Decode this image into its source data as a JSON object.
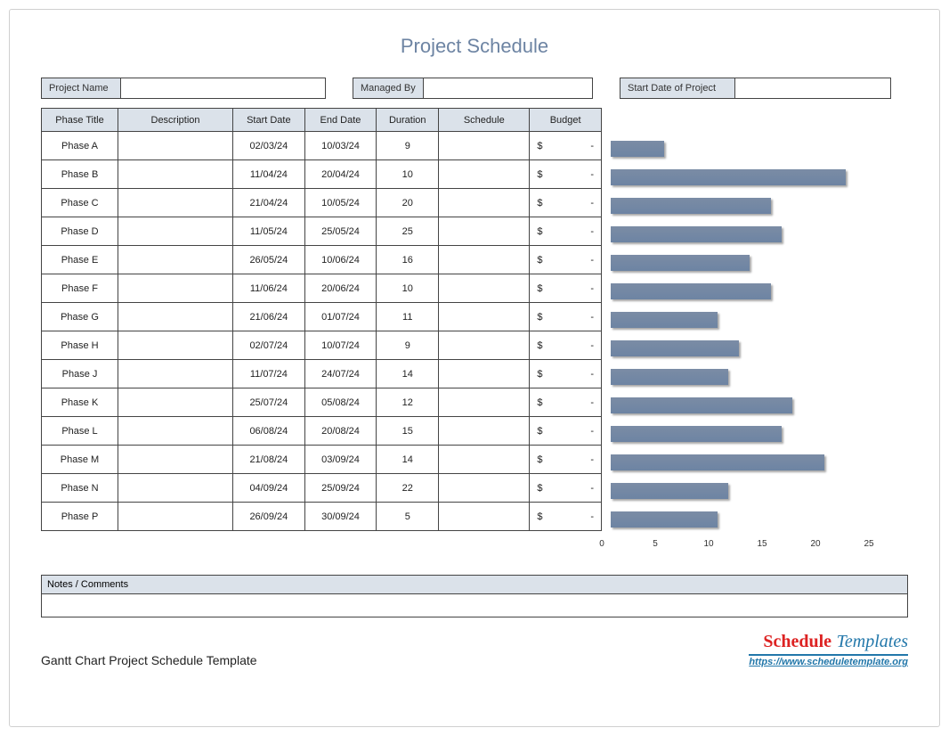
{
  "page": {
    "title": "Project Schedule",
    "footer_left": "Gantt Chart Project Schedule Template",
    "footer_brand_a": "Schedule",
    "footer_brand_b": "Templates",
    "footer_url": "https://www.scheduletemplate.org"
  },
  "meta": {
    "project_name_label": "Project Name",
    "project_name_value": "",
    "managed_by_label": "Managed By",
    "managed_by_value": "",
    "start_date_label": "Start Date of Project",
    "start_date_value": ""
  },
  "columns": {
    "phase": "Phase Title",
    "desc": "Description",
    "start": "Start Date",
    "end": "End Date",
    "dur": "Duration",
    "sched": "Schedule",
    "budget": "Budget"
  },
  "budget_prefix": "$",
  "budget_dash": "-",
  "notes_label": "Notes / Comments",
  "rows": [
    {
      "phase": "Phase A",
      "desc": "",
      "start": "02/03/24",
      "end": "10/03/24",
      "dur": "9",
      "sched": "",
      "budget": "",
      "bar": 5
    },
    {
      "phase": "Phase B",
      "desc": "",
      "start": "11/04/24",
      "end": "20/04/24",
      "dur": "10",
      "sched": "",
      "budget": "",
      "bar": 22
    },
    {
      "phase": "Phase C",
      "desc": "",
      "start": "21/04/24",
      "end": "10/05/24",
      "dur": "20",
      "sched": "",
      "budget": "",
      "bar": 15
    },
    {
      "phase": "Phase D",
      "desc": "",
      "start": "11/05/24",
      "end": "25/05/24",
      "dur": "25",
      "sched": "",
      "budget": "",
      "bar": 16
    },
    {
      "phase": "Phase E",
      "desc": "",
      "start": "26/05/24",
      "end": "10/06/24",
      "dur": "16",
      "sched": "",
      "budget": "",
      "bar": 13
    },
    {
      "phase": "Phase F",
      "desc": "",
      "start": "11/06/24",
      "end": "20/06/24",
      "dur": "10",
      "sched": "",
      "budget": "",
      "bar": 15
    },
    {
      "phase": "Phase G",
      "desc": "",
      "start": "21/06/24",
      "end": "01/07/24",
      "dur": "11",
      "sched": "",
      "budget": "",
      "bar": 10
    },
    {
      "phase": "Phase H",
      "desc": "",
      "start": "02/07/24",
      "end": "10/07/24",
      "dur": "9",
      "sched": "",
      "budget": "",
      "bar": 12
    },
    {
      "phase": "Phase J",
      "desc": "",
      "start": "11/07/24",
      "end": "24/07/24",
      "dur": "14",
      "sched": "",
      "budget": "",
      "bar": 11
    },
    {
      "phase": "Phase K",
      "desc": "",
      "start": "25/07/24",
      "end": "05/08/24",
      "dur": "12",
      "sched": "",
      "budget": "",
      "bar": 17
    },
    {
      "phase": "Phase L",
      "desc": "",
      "start": "06/08/24",
      "end": "20/08/24",
      "dur": "15",
      "sched": "",
      "budget": "",
      "bar": 16
    },
    {
      "phase": "Phase M",
      "desc": "",
      "start": "21/08/24",
      "end": "03/09/24",
      "dur": "14",
      "sched": "",
      "budget": "",
      "bar": 20
    },
    {
      "phase": "Phase N",
      "desc": "",
      "start": "04/09/24",
      "end": "25/09/24",
      "dur": "22",
      "sched": "",
      "budget": "",
      "bar": 11
    },
    {
      "phase": "Phase P",
      "desc": "",
      "start": "26/09/24",
      "end": "30/09/24",
      "dur": "5",
      "sched": "",
      "budget": "",
      "bar": 10
    }
  ],
  "chart_data": {
    "type": "bar",
    "orientation": "horizontal",
    "title": "",
    "xlabel": "",
    "ylabel": "",
    "xlim": [
      0,
      25
    ],
    "xticks": [
      0,
      5,
      10,
      15,
      20,
      25
    ],
    "categories": [
      "Phase A",
      "Phase B",
      "Phase C",
      "Phase D",
      "Phase E",
      "Phase F",
      "Phase G",
      "Phase H",
      "Phase J",
      "Phase K",
      "Phase L",
      "Phase M",
      "Phase N",
      "Phase P"
    ],
    "values": [
      5,
      22,
      15,
      16,
      13,
      15,
      10,
      12,
      11,
      17,
      16,
      20,
      11,
      10
    ],
    "bar_color": "#6d84a3"
  }
}
